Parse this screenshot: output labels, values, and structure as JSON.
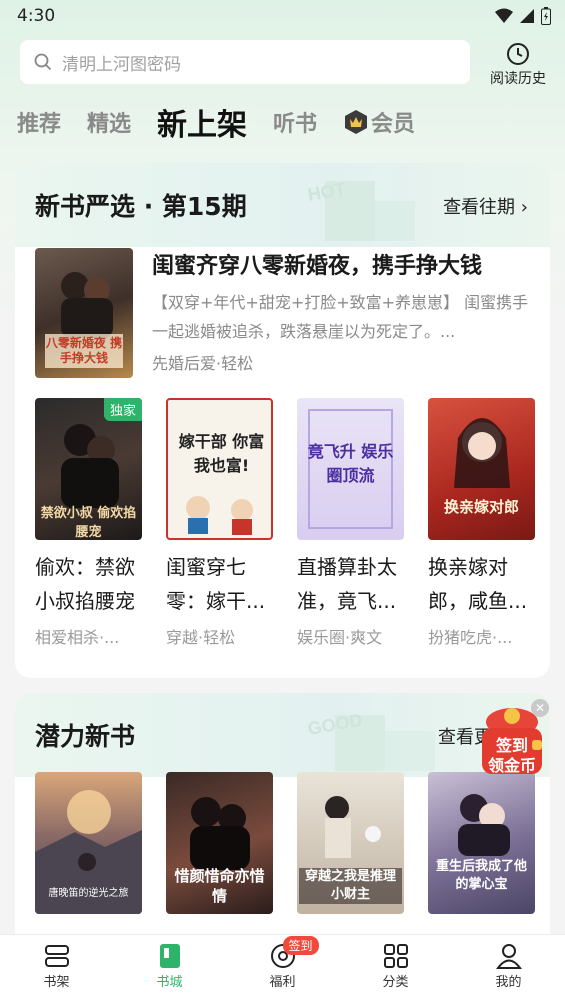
{
  "status": {
    "time": "4:30"
  },
  "search": {
    "placeholder": "清明上河图密码"
  },
  "history": {
    "label": "阅读历史"
  },
  "tabs": [
    {
      "label": "推荐"
    },
    {
      "label": "精选"
    },
    {
      "label": "新上架",
      "active": true
    },
    {
      "label": "听书"
    },
    {
      "label": "会员",
      "icon": "vip-crown-icon"
    }
  ],
  "section1": {
    "title": "新书严选 · 第15期",
    "more": "查看往期",
    "featured": {
      "title": "闺蜜齐穿八零新婚夜，携手挣大钱",
      "desc": "【双穿+年代+甜宠+打脸+致富+养崽崽】 闺蜜携手一起逃婚被追杀，跌落悬崖以为死定了。...",
      "tags": "先婚后爱·轻松",
      "cover_text": "八零新婚夜 携手挣大钱"
    },
    "books": [
      {
        "title": "偷欢：禁欲小叔掐腰宠",
        "tags": "相爱相杀·...",
        "badge": "独家",
        "cover_text": "禁欲小叔 偷欢掐腰宠"
      },
      {
        "title": "闺蜜穿七零：嫁干...",
        "tags": "穿越·轻松",
        "cover_text": "嫁干部 你富我也富!"
      },
      {
        "title": "直播算卦太准，竟飞...",
        "tags": "娱乐圈·爽文",
        "cover_text": "竟飞升 娱乐圈顶流"
      },
      {
        "title": "换亲嫁对郎，咸鱼...",
        "tags": "扮猪吃虎·...",
        "cover_text": "换亲嫁对郎"
      }
    ]
  },
  "section2": {
    "title": "潜力新书",
    "more": "查看更多",
    "books": [
      {
        "cover_text": "唐晚笛的逆光之旅"
      },
      {
        "cover_text": "惜颜惜命亦惜情"
      },
      {
        "cover_text": "穿越之我是推理小财主"
      },
      {
        "cover_text": "重生后我成了他的掌心宝"
      }
    ]
  },
  "promo": {
    "line1": "签到",
    "line2": "领金币"
  },
  "nav": [
    {
      "label": "书架",
      "icon": "bookshelf-icon"
    },
    {
      "label": "书城",
      "icon": "bookstore-icon",
      "active": true
    },
    {
      "label": "福利",
      "icon": "welfare-icon",
      "badge": "签到"
    },
    {
      "label": "分类",
      "icon": "category-icon"
    },
    {
      "label": "我的",
      "icon": "profile-icon"
    }
  ],
  "colors": {
    "accent": "#2db46a",
    "badge": "#ef4a3b"
  }
}
